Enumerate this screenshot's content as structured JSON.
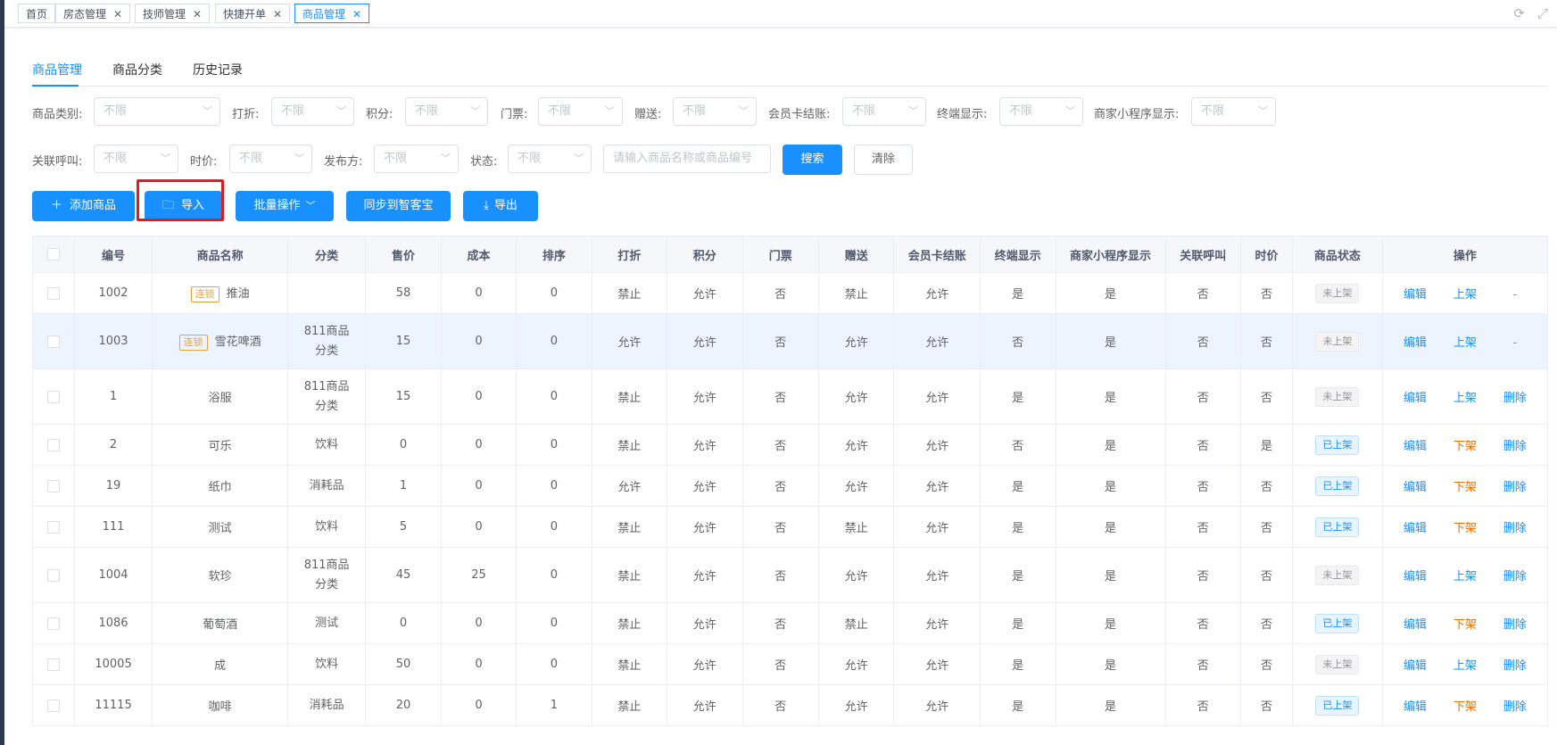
{
  "page_tabs": [
    {
      "label": "首页",
      "closable": false,
      "active": false
    },
    {
      "label": "房态管理",
      "closable": true,
      "active": false
    },
    {
      "label": "技师管理",
      "closable": true,
      "active": false
    },
    {
      "label": "快捷开单",
      "closable": false,
      "active": false
    },
    {
      "label": "商品管理",
      "closable": true,
      "active": true
    }
  ],
  "sub_tabs": [
    {
      "label": "商品管理",
      "active": true
    },
    {
      "label": "商品分类",
      "active": false
    },
    {
      "label": "历史记录",
      "active": false
    }
  ],
  "filters": {
    "category": {
      "label": "商品类别:",
      "value": "不限"
    },
    "discount": {
      "label": "打折:",
      "value": "不限"
    },
    "points": {
      "label": "积分:",
      "value": "不限"
    },
    "ticket": {
      "label": "门票:",
      "value": "不限"
    },
    "gift": {
      "label": "赠送:",
      "value": "不限"
    },
    "member_card": {
      "label": "会员卡结账:",
      "value": "不限"
    },
    "terminal": {
      "label": "终端显示:",
      "value": "不限"
    },
    "mini_program": {
      "label": "商家小程序显示:",
      "value": "不限"
    },
    "call": {
      "label": "关联呼叫:",
      "value": "不限"
    },
    "time_price": {
      "label": "时价:",
      "value": "不限"
    },
    "publisher": {
      "label": "发布方:",
      "value": "不限"
    },
    "status": {
      "label": "状态:",
      "value": "不限"
    },
    "search_placeholder": "请输入商品名称或商品编号",
    "search_label": "搜索",
    "clear_label": "清除"
  },
  "actions": {
    "add": "添加商品",
    "import": "导入",
    "batch": "批量操作",
    "sync": "同步到智客宝",
    "export": "导出"
  },
  "table": {
    "headers": [
      "编号",
      "商品名称",
      "分类",
      "售价",
      "成本",
      "排序",
      "打折",
      "积分",
      "门票",
      "赠送",
      "会员卡结账",
      "终端显示",
      "商家小程序显示",
      "关联呼叫",
      "时价",
      "商品状态",
      "操作"
    ],
    "rows": [
      {
        "id": "1002",
        "lock": "连锁",
        "name": "推油",
        "category": "",
        "price": "58",
        "cost": "0",
        "sort": "0",
        "discount": "禁止",
        "points": "允许",
        "ticket": "否",
        "gift": "禁止",
        "member": "允许",
        "terminal": "是",
        "mini": "是",
        "call": "否",
        "timeprice": "否",
        "status": "未上架",
        "edit": "编辑",
        "toggle": "上架",
        "delete": "-"
      },
      {
        "id": "1003",
        "lock": "连锁",
        "name": "雪花啤酒",
        "category": "811商品分类",
        "price": "15",
        "cost": "0",
        "sort": "0",
        "discount": "允许",
        "points": "允许",
        "ticket": "否",
        "gift": "允许",
        "member": "允许",
        "terminal": "否",
        "mini": "是",
        "call": "否",
        "timeprice": "否",
        "status": "未上架",
        "edit": "编辑",
        "toggle": "上架",
        "delete": "-"
      },
      {
        "id": "1",
        "lock": "",
        "name": "浴服",
        "category": "811商品分类",
        "price": "15",
        "cost": "0",
        "sort": "0",
        "discount": "禁止",
        "points": "允许",
        "ticket": "否",
        "gift": "允许",
        "member": "允许",
        "terminal": "是",
        "mini": "是",
        "call": "否",
        "timeprice": "否",
        "status": "未上架",
        "edit": "编辑",
        "toggle": "上架",
        "delete": "删除"
      },
      {
        "id": "2",
        "lock": "",
        "name": "可乐",
        "category": "饮料",
        "price": "0",
        "cost": "0",
        "sort": "0",
        "discount": "禁止",
        "points": "允许",
        "ticket": "否",
        "gift": "允许",
        "member": "允许",
        "terminal": "否",
        "mini": "是",
        "call": "否",
        "timeprice": "是",
        "status": "已上架",
        "edit": "编辑",
        "toggle": "下架",
        "delete": "删除"
      },
      {
        "id": "19",
        "lock": "",
        "name": "纸巾",
        "category": "消耗品",
        "price": "1",
        "cost": "0",
        "sort": "0",
        "discount": "允许",
        "points": "允许",
        "ticket": "否",
        "gift": "允许",
        "member": "允许",
        "terminal": "是",
        "mini": "是",
        "call": "否",
        "timeprice": "否",
        "status": "已上架",
        "edit": "编辑",
        "toggle": "下架",
        "delete": "删除"
      },
      {
        "id": "111",
        "lock": "",
        "name": "测试",
        "category": "饮料",
        "price": "5",
        "cost": "0",
        "sort": "0",
        "discount": "禁止",
        "points": "允许",
        "ticket": "否",
        "gift": "禁止",
        "member": "允许",
        "terminal": "是",
        "mini": "是",
        "call": "否",
        "timeprice": "否",
        "status": "已上架",
        "edit": "编辑",
        "toggle": "下架",
        "delete": "删除"
      },
      {
        "id": "1004",
        "lock": "",
        "name": "软珍",
        "category": "811商品分类",
        "price": "45",
        "cost": "25",
        "sort": "0",
        "discount": "禁止",
        "points": "允许",
        "ticket": "否",
        "gift": "允许",
        "member": "允许",
        "terminal": "是",
        "mini": "是",
        "call": "否",
        "timeprice": "否",
        "status": "未上架",
        "edit": "编辑",
        "toggle": "上架",
        "delete": "删除"
      },
      {
        "id": "1086",
        "lock": "",
        "name": "葡萄酒",
        "category": "测试",
        "price": "0",
        "cost": "0",
        "sort": "0",
        "discount": "禁止",
        "points": "允许",
        "ticket": "否",
        "gift": "禁止",
        "member": "允许",
        "terminal": "是",
        "mini": "是",
        "call": "否",
        "timeprice": "否",
        "status": "已上架",
        "edit": "编辑",
        "toggle": "下架",
        "delete": "删除"
      },
      {
        "id": "10005",
        "lock": "",
        "name": "成",
        "category": "饮料",
        "price": "50",
        "cost": "0",
        "sort": "0",
        "discount": "禁止",
        "points": "允许",
        "ticket": "否",
        "gift": "允许",
        "member": "允许",
        "terminal": "是",
        "mini": "是",
        "call": "否",
        "timeprice": "否",
        "status": "未上架",
        "edit": "编辑",
        "toggle": "上架",
        "delete": "删除"
      },
      {
        "id": "11115",
        "lock": "",
        "name": "咖啡",
        "category": "消耗品",
        "price": "20",
        "cost": "0",
        "sort": "1",
        "discount": "禁止",
        "points": "允许",
        "ticket": "否",
        "gift": "允许",
        "member": "允许",
        "terminal": "是",
        "mini": "是",
        "call": "否",
        "timeprice": "否",
        "status": "已上架",
        "edit": "编辑",
        "toggle": "下架",
        "delete": "删除"
      }
    ]
  },
  "colors": {
    "primary": "#1890ff",
    "highlight_border": "#e6191e",
    "warning": "#f56c00"
  }
}
